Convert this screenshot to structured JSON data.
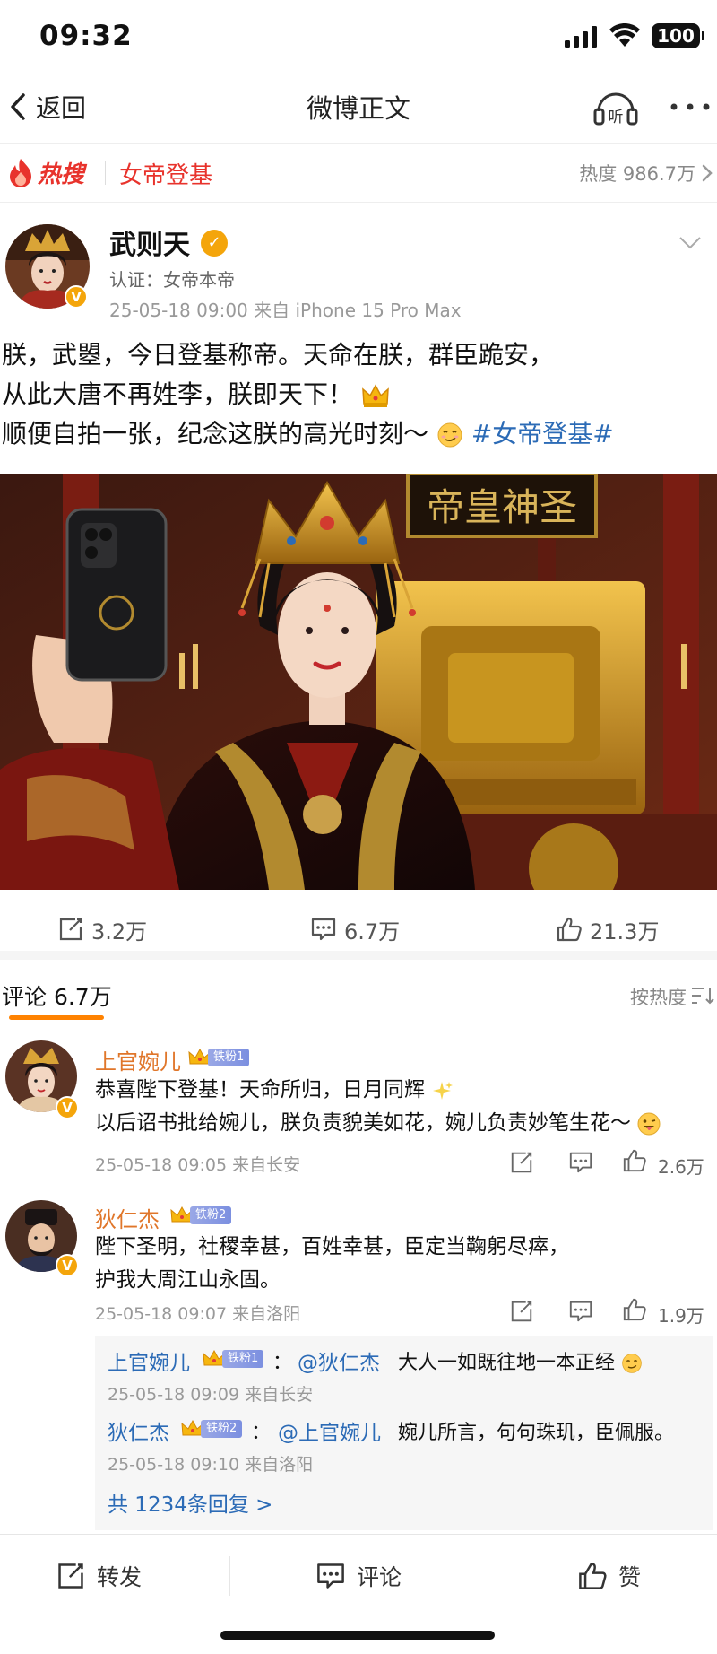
{
  "status_bar": {
    "time": "09:32",
    "battery": "100"
  },
  "nav": {
    "back_label": "返回",
    "title": "微博正文",
    "listen_label": "听"
  },
  "hot_search": {
    "brand": "热搜",
    "topic": "女帝登基",
    "heat": "热度 986.7万"
  },
  "post": {
    "author": "武则天",
    "verified": "认证：女帝本帝",
    "meta": "25-05-18 09:00  来自 iPhone 15 Pro Max",
    "text_line1": "朕，武曌，今日登基称帝。天命在朕，群臣跪安，",
    "text_line2": "从此大唐不再姓李，朕即天下！",
    "text_line3": "顺便自拍一张，纪念这朕的高光时刻～",
    "hashtag": "#女帝登基#",
    "image_sign": "帝皇神圣",
    "reposts": "3.2万",
    "comments": "6.7万",
    "likes": "21.3万"
  },
  "comments_header": {
    "title": "评论 6.7万",
    "sort": "按热度"
  },
  "comments": [
    {
      "name": "上官婉儿",
      "fan": "铁粉1",
      "line1": "恭喜陛下登基！天命所归，日月同辉",
      "line2": "以后诏书批给婉儿，朕负责貌美如花，婉儿负责妙笔生花～",
      "meta": "25-05-18 09:05  来自长安",
      "likes": "2.6万"
    },
    {
      "name": "狄仁杰",
      "fan": "铁粉2",
      "line1": "陛下圣明，社稷幸甚，百姓幸甚，臣定当鞠躬尽瘁，",
      "line2": "护我大周江山永固。",
      "meta": "25-05-18 09:07  来自洛阳",
      "likes": "1.9万"
    }
  ],
  "replies": [
    {
      "name": "上官婉儿",
      "fan": "铁粉1",
      "sep": "：",
      "at": "@狄仁杰",
      "text": "大人一如既往地一本正经",
      "meta": "25-05-18 09:09  来自长安"
    },
    {
      "name": "狄仁杰",
      "fan": "铁粉2",
      "sep": "：",
      "at": "@上官婉儿",
      "text": "婉儿所言，句句珠玑，臣佩服。",
      "meta": "25-05-18 09:10  来自洛阳"
    }
  ],
  "replies_more": "共 1234条回复 >",
  "bottom_bar": {
    "repost": "转发",
    "comment": "评论",
    "like": "赞"
  },
  "colors": {
    "orange": "#ff8200",
    "hot_red": "#e8332c",
    "link_blue": "#2c6bb6",
    "name_orange": "#e0762a",
    "gold": "#f4a50b"
  }
}
